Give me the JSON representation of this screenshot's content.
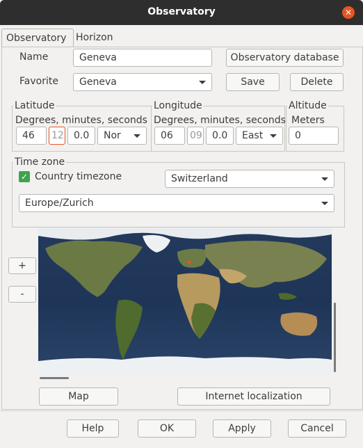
{
  "window": {
    "title": "Observatory"
  },
  "tabs": [
    {
      "label": "Observatory"
    },
    {
      "label": "Horizon"
    }
  ],
  "fields": {
    "name_label": "Name",
    "name_value": "Geneva",
    "favorite_label": "Favorite",
    "favorite_value": "Geneva"
  },
  "buttons": {
    "observatory_database": "Observatory database",
    "save": "Save",
    "delete": "Delete",
    "zoom_in": "+",
    "zoom_out": "-",
    "map": "Map",
    "internet_localization": "Internet localization",
    "help": "Help",
    "ok": "OK",
    "apply": "Apply",
    "cancel": "Cancel"
  },
  "latitude": {
    "legend": "Latitude",
    "sublabel": "Degrees, minutes, seconds",
    "degrees": "46",
    "minutes": "12",
    "seconds": "0.0",
    "hemisphere": "Nor"
  },
  "longitude": {
    "legend": "Longitude",
    "sublabel": "Degrees, minutes, seconds",
    "degrees": "06",
    "minutes": "09",
    "seconds": "0.0",
    "hemisphere": "East"
  },
  "altitude": {
    "legend": "Altitude",
    "sublabel": "Meters",
    "value": "0"
  },
  "timezone": {
    "legend": "Time zone",
    "country_label": "Country timezone",
    "country_checked": true,
    "country_value": "Switzerland",
    "zone_value": "Europe/Zurich"
  },
  "icons": {
    "close": "close-icon",
    "check": "checkmark-icon",
    "dropdown": "chevron-down-icon"
  },
  "colors": {
    "accent": "#e95420",
    "check": "#3fa34d",
    "titlebar": "#2e2e2e"
  }
}
